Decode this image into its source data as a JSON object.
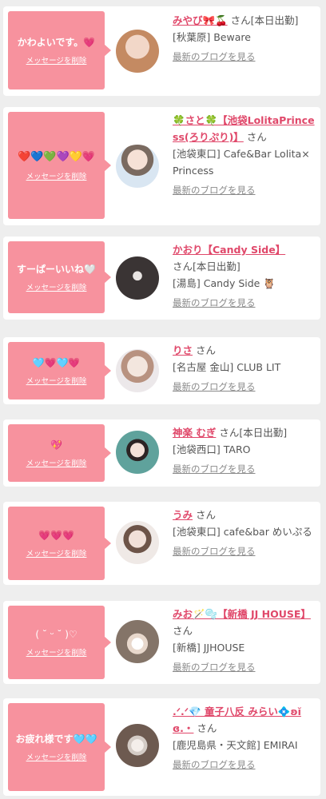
{
  "delete_label": "メッセージを削除",
  "blog_label": "最新のブログを見る",
  "items": [
    {
      "message": "かわよいです。💗",
      "name": "みやび🎀🍒",
      "suffix": "さん[本日出勤]",
      "shop": "[秋葉原] Beware",
      "avatar_colors": [
        "#f2d7c8",
        "#c48a62"
      ]
    },
    {
      "message": "❤️💙💚💜💛💗",
      "name": "🍀さと🍀【池袋LolitaPrincess(ろりぷり)】",
      "suffix": "さん",
      "shop": "[池袋東口] Cafe&Bar Lolita×Princess",
      "avatar_colors": [
        "#d9e6f2",
        "#7a6a60"
      ]
    },
    {
      "message": "すーぱーいいね🤍",
      "name": "かおり【Candy Side】",
      "suffix": "さん[本日出勤]",
      "shop": "[湯島] Candy Side 🦉",
      "avatar_colors": [
        "#3a3434",
        "#1a1616"
      ]
    },
    {
      "message": "🩵💗🩵💗",
      "name": "りさ",
      "suffix": "さん",
      "shop": "[名古屋 金山] CLUB LIT",
      "avatar_colors": [
        "#f0e4dc",
        "#b89280"
      ]
    },
    {
      "message": "💖",
      "name": "神楽 むぎ",
      "suffix": "さん[本日出勤]",
      "shop": "[池袋西口] TARO",
      "avatar_colors": [
        "#5fa29c",
        "#2c5752"
      ]
    },
    {
      "message": "💗💗💗",
      "name": "うみ",
      "suffix": "さん",
      "shop": "[池袋東口] cafe&bar めいぷる",
      "avatar_colors": [
        "#efe9e6",
        "#a08a80"
      ]
    },
    {
      "message": "( ˘ ᵕ ˘ )♡",
      "name": "みお🪄🫧【新橋 JJ HOUSE】",
      "suffix": "さん",
      "shop": "[新橋] JJHOUSE",
      "avatar_colors": [
        "#d8d3d0",
        "#847468"
      ]
    },
    {
      "message": "お疲れ様です🩵🩵",
      "name": ".ᐟ.ᐟ💎 童子八反 みらい💠ʚĭɞ.・",
      "suffix": "さん",
      "shop": "[鹿児島県・天文館] EMIRAI",
      "avatar_colors": [
        "#d4ccc6",
        "#6d5a50"
      ]
    }
  ]
}
